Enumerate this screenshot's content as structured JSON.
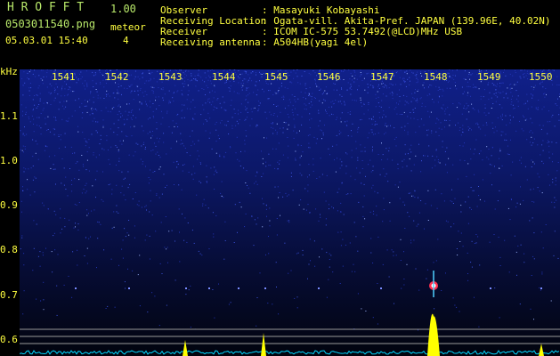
{
  "app": {
    "name": "H R O F F T",
    "version": "1.00",
    "filename": "0503011540.png",
    "datetime": "05.03.01 15:40",
    "meteor_label": "meteor",
    "meteor_count": "4"
  },
  "info": {
    "rows": [
      {
        "key": "Observer",
        "value": ": Masayuki Kobayashi"
      },
      {
        "key": "Receiving Location",
        "value": ": Ogata-vill. Akita-Pref. JAPAN (139.96E, 40.02N)"
      },
      {
        "key": "Receiver",
        "value": ": ICOM IC-575 53.7492(@LCD)MHz USB"
      },
      {
        "key": "Receiving antenna",
        "value": ": A504HB(yagi 4el)"
      }
    ]
  },
  "axis": {
    "y_unit": "kHz",
    "y_ticks": [
      "1.1",
      "1.0",
      "0.9",
      "0.8",
      "0.7",
      "0.6"
    ],
    "x_ticks": [
      "1541",
      "1542",
      "1543",
      "1544",
      "1545",
      "1546",
      "1547",
      "1548",
      "1549",
      "1550"
    ]
  },
  "colors": {
    "background": "#000000",
    "noise_blue": "#2030c0",
    "signal_yellow": "#ffff00",
    "baseline_cyan": "#00e0ff",
    "label_yellow": "#ffff40",
    "title_green": "#b8e86a"
  }
}
